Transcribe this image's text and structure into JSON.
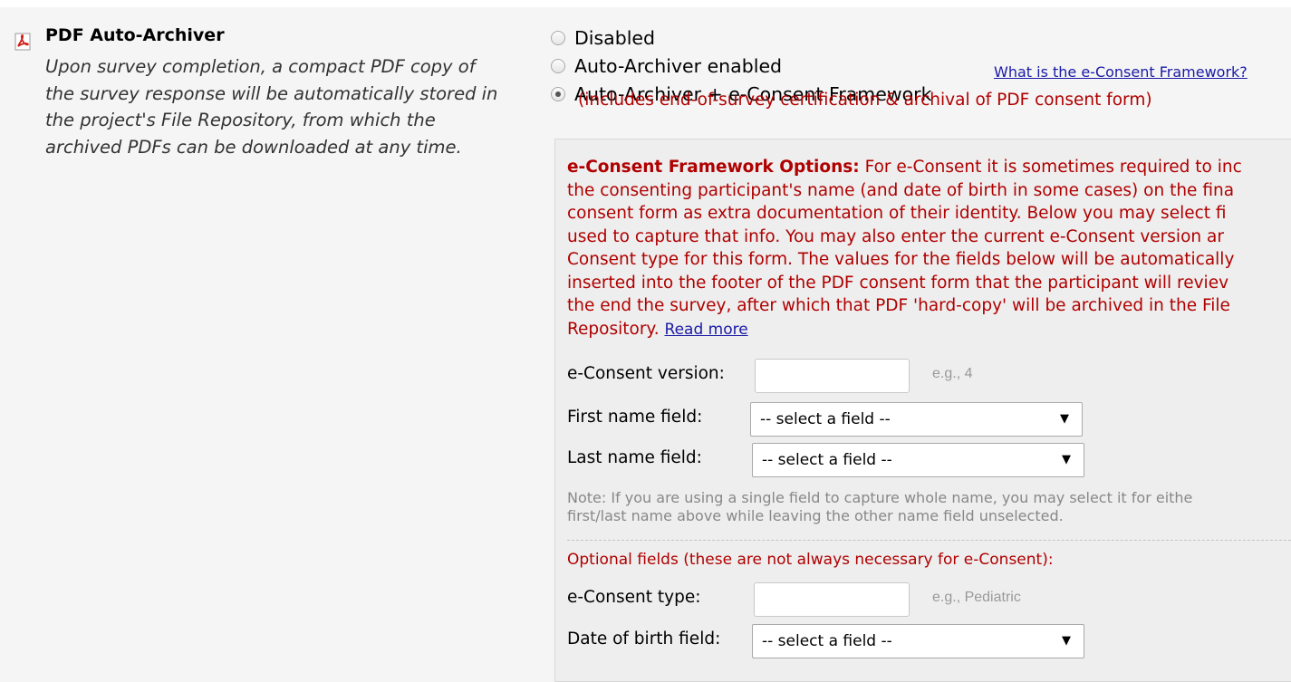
{
  "setting": {
    "title": "PDF Auto-Archiver",
    "icon": "pdf-file-icon",
    "description_lines": [
      "Upon survey completion, a compact PDF copy of",
      "the survey response will be automatically stored in",
      "the project's File Repository, from which the",
      "archived PDFs can be downloaded at any time."
    ]
  },
  "radio_options": [
    {
      "label": "Disabled",
      "checked": false
    },
    {
      "label": "Auto-Archiver enabled",
      "checked": false
    },
    {
      "label": "Auto-Archiver + e-Consent Framework",
      "checked": true
    }
  ],
  "whatis_link": "What is the e-Consent Framework?",
  "includes_note": "(includes end-of-survey certification & archival of PDF consent form)",
  "econsent": {
    "options_heading": "e-Consent Framework Options:",
    "text_lines": [
      "For e-Consent it is sometimes required to inc",
      "the consenting participant's name (and date of birth in some cases) on the fina",
      "consent form as extra documentation of their identity. Below you may select fi",
      "used to capture that info. You may also enter the current e-Consent version ar",
      "Consent type for this form. The values for the fields below will be automatically",
      "inserted into the footer of the PDF consent form that the participant will reviev",
      "the end the survey, after which that PDF 'hard-copy' will be archived in the File",
      "Repository."
    ],
    "read_more": "Read more",
    "version_label": "e-Consent version:",
    "version_value": "",
    "version_example": "e.g., 4",
    "first_name_label": "First name field:",
    "first_name_select": "-- select a field --",
    "last_name_label": "Last name field:",
    "last_name_select": "-- select a field --",
    "note_lines": [
      "Note: If you are using a single field to capture whole name, you may select it for eithe",
      "first/last name above while leaving the other name field unselected."
    ],
    "optional_heading": "Optional fields (these are not always necessary for e-Consent):",
    "type_label": "e-Consent type:",
    "type_value": "",
    "type_example": "e.g., Pediatric",
    "dob_label": "Date of birth field:",
    "dob_select": "-- select a field --"
  },
  "colors": {
    "accent_red": "#b00000",
    "link_blue": "#1a1aa6",
    "background": "#f5f5f5",
    "panel": "#eeeeee"
  }
}
